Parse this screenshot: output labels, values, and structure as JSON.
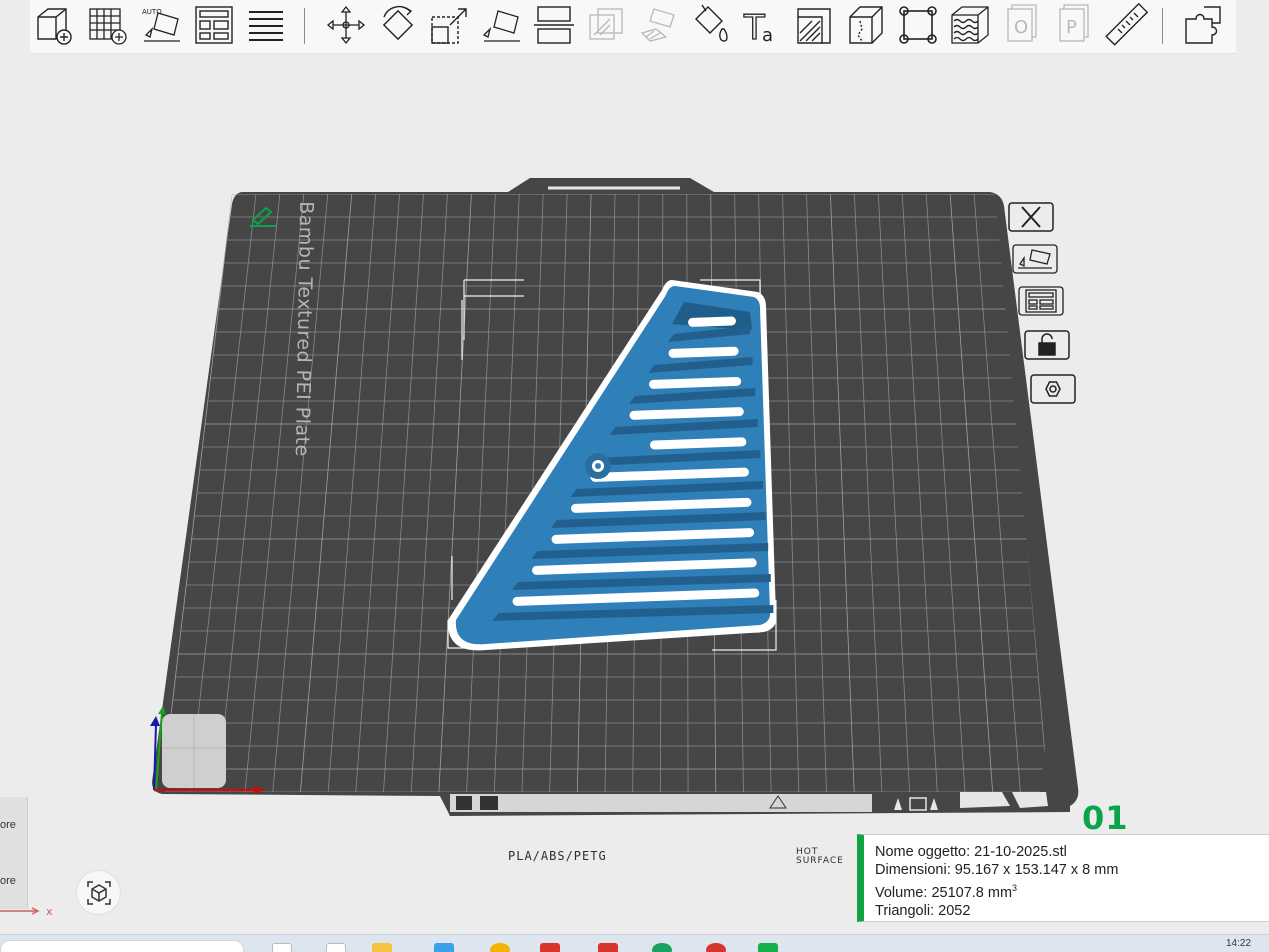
{
  "toolbar": {
    "tools": [
      {
        "name": "add-object-icon"
      },
      {
        "name": "add-plate-icon"
      },
      {
        "name": "auto-orient-icon",
        "label": "AUTO"
      },
      {
        "name": "arrange-icon"
      },
      {
        "name": "split-objects-icon"
      },
      {
        "name": "move-icon"
      },
      {
        "name": "rotate-icon"
      },
      {
        "name": "scale-icon"
      },
      {
        "name": "lay-on-face-icon"
      },
      {
        "name": "cut-icon"
      },
      {
        "name": "mesh-boolean-icon"
      },
      {
        "name": "support-painting-icon"
      },
      {
        "name": "color-painting-icon"
      },
      {
        "name": "text-shape-icon",
        "label": "Ta"
      },
      {
        "name": "seam-painting-icon"
      },
      {
        "name": "variable-layer-height-icon"
      },
      {
        "name": "fit-view-icon"
      },
      {
        "name": "fuzzy-skin-icon"
      },
      {
        "name": "object-list-icon",
        "label": "O"
      },
      {
        "name": "plate-list-icon",
        "label": "P"
      },
      {
        "name": "measure-icon"
      },
      {
        "name": "assembly-icon"
      }
    ]
  },
  "plate": {
    "name": "Bambu Textured PEI Plate",
    "number": "01",
    "strip_label": "PLA/ABS/PETG",
    "hot_label_1": "HOT",
    "hot_label_2": "SURFACE"
  },
  "info": {
    "name_label": "Nome oggetto:",
    "name_value": "21-10-2025.stl",
    "dim_label": "Dimensioni:",
    "dim_value": "95.167 x 153.147 x 8 mm",
    "vol_label": "Volume:",
    "vol_value": "25107.8 mm",
    "vol_sup": "3",
    "tri_label": "Triangoli:",
    "tri_value": "2052"
  },
  "left_panel": {
    "item1": "ore",
    "item2": "ore"
  },
  "axis": {
    "x_label": "x"
  },
  "taskbar": {
    "time": "14:22"
  },
  "colors": {
    "accent": "#0aa44a",
    "plate": "#464646",
    "object": "#2f7fb8"
  }
}
